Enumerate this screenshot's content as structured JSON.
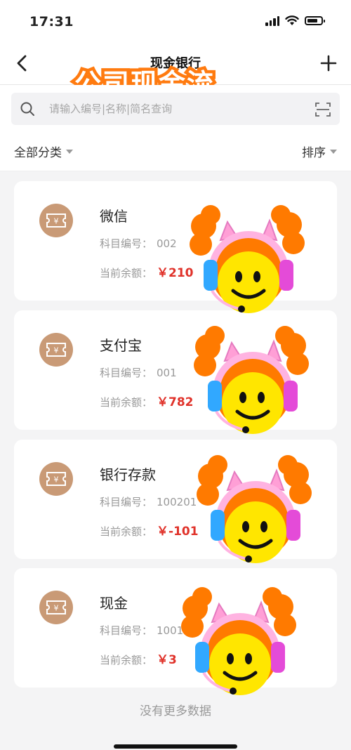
{
  "status_bar": {
    "time": "17:31"
  },
  "nav": {
    "title": "现金银行",
    "overlay_caption": "公司现金流"
  },
  "search": {
    "placeholder": "请输入编号|名称|简名查询",
    "value": ""
  },
  "filters": {
    "category": "全部分类",
    "sort": "排序"
  },
  "accounts": [
    {
      "name": "微信",
      "code_label": "科目编号：",
      "code": "002",
      "balance_label": "当前余额：",
      "balance": "￥210"
    },
    {
      "name": "支付宝",
      "code_label": "科目编号：",
      "code": "001",
      "balance_label": "当前余额：",
      "balance": "￥782"
    },
    {
      "name": "银行存款",
      "code_label": "科目编号：",
      "code": "100201",
      "balance_label": "当前余额：",
      "balance": "￥-101"
    },
    {
      "name": "现金",
      "code_label": "科目编号：",
      "code": "100101",
      "balance_label": "当前余额：",
      "balance": "￥3"
    }
  ],
  "footer": {
    "no_more": "没有更多数据"
  },
  "icons": {
    "back": "chevron-left-icon",
    "add": "plus-icon",
    "search": "search-icon",
    "scan": "scan-icon",
    "account": "ticket-icon"
  },
  "colors": {
    "balance": "#e0322a",
    "account_icon_bg": "#c99a76",
    "caption_stroke": "#ff7b10"
  }
}
